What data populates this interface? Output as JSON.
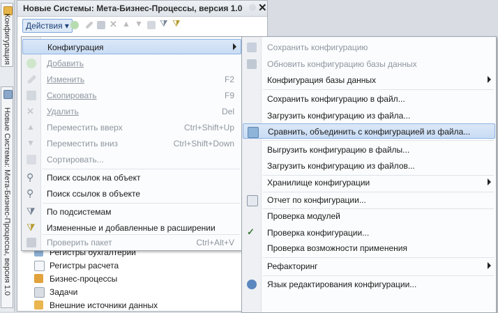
{
  "sidebar": {
    "tabs": [
      {
        "label": "Конфигурация"
      },
      {
        "label": "Новые Системы: Мета-Бизнес-Процессы, версия 1.0"
      }
    ]
  },
  "panel": {
    "title": "Новые Системы: Мета-Бизнес-Процессы, версия 1.0",
    "close_glyph": "✕",
    "actions_label": "Действия ▾",
    "toolbar_icons": [
      "add-icon",
      "edit-icon",
      "copy-icon",
      "delete-icon",
      "move-up-icon",
      "move-down-icon",
      "sort-icon",
      "filter-icon",
      "filter-changed-icon"
    ]
  },
  "tree": [
    {
      "label": "Регистры бухгалтерии",
      "icon": "accounting-register-icon"
    },
    {
      "label": "Регистры расчета",
      "icon": "calculation-register-icon"
    },
    {
      "label": "Бизнес-процессы",
      "icon": "business-process-icon"
    },
    {
      "label": "Задачи",
      "icon": "task-icon"
    },
    {
      "label": "Внешние источники данных",
      "icon": "external-data-source-icon"
    }
  ],
  "actions_menu": [
    {
      "label": "Конфигурация",
      "shortcut": "",
      "disabled": false,
      "highlighted": true,
      "submenu": true,
      "icon": ""
    },
    {
      "label": "Добавить",
      "shortcut": "",
      "disabled": true,
      "underline": true,
      "icon": "add-icon"
    },
    {
      "label": "Изменить",
      "shortcut": "F2",
      "disabled": true,
      "underline": true,
      "icon": "edit-icon"
    },
    {
      "label": "Скопировать",
      "shortcut": "F9",
      "disabled": true,
      "underline": true,
      "icon": "copy-icon"
    },
    {
      "label": "Удалить",
      "shortcut": "Del",
      "disabled": true,
      "underline": true,
      "icon": "delete-icon"
    },
    {
      "label": "Переместить вверх",
      "shortcut": "Ctrl+Shift+Up",
      "disabled": true,
      "icon": "move-up-icon"
    },
    {
      "label": "Переместить вниз",
      "shortcut": "Ctrl+Shift+Down",
      "disabled": true,
      "icon": "move-down-icon"
    },
    {
      "label": "Сортировать...",
      "shortcut": "",
      "disabled": true,
      "icon": "sort-icon"
    },
    {
      "label": "Поиск ссылок на объект",
      "shortcut": "",
      "disabled": false,
      "icon": "find-references-icon"
    },
    {
      "label": "Поиск ссылок в объекте",
      "shortcut": "",
      "disabled": false,
      "icon": "find-in-object-icon"
    },
    {
      "label": "По подсистемам",
      "shortcut": "",
      "disabled": false,
      "icon": "subsystems-filter-icon"
    },
    {
      "label": "Измененные и добавленные в расширении",
      "shortcut": "",
      "disabled": false,
      "icon": "extension-changes-icon"
    },
    {
      "label": "Проверить пакет",
      "shortcut": "Ctrl+Alt+V",
      "disabled": true,
      "icon": "check-package-icon"
    }
  ],
  "config_submenu": [
    {
      "label": "Сохранить конфигурацию",
      "disabled": true,
      "icon": "save-config-icon"
    },
    {
      "label": "Обновить конфигурацию базы данных",
      "disabled": true,
      "icon": "update-db-icon"
    },
    {
      "label": "Конфигурация базы данных",
      "disabled": false,
      "submenu": true
    },
    {
      "label": "Сохранить конфигурацию в файл...",
      "disabled": false
    },
    {
      "label": "Загрузить конфигурацию из файла...",
      "disabled": false
    },
    {
      "label": "Сравнить, объединить с конфигурацией из файла...",
      "disabled": false,
      "highlighted": true,
      "icon": "compare-merge-icon"
    },
    {
      "label": "Выгрузить конфигурацию в файлы...",
      "disabled": false
    },
    {
      "label": "Загрузить конфигурацию из файлов...",
      "disabled": false
    },
    {
      "label": "Хранилище конфигурации",
      "disabled": false,
      "submenu": true
    },
    {
      "label": "Отчет по конфигурации...",
      "disabled": false,
      "icon": "report-icon"
    },
    {
      "label": "Проверка модулей",
      "disabled": false
    },
    {
      "label": "Проверка конфигурации...",
      "disabled": false,
      "icon": "check-config-icon"
    },
    {
      "label": "Проверка возможности применения",
      "disabled": false
    },
    {
      "label": "Рефакторинг",
      "disabled": false,
      "submenu": true
    },
    {
      "label": "Язык редактирования конфигурации...",
      "disabled": false,
      "icon": "language-icon"
    }
  ],
  "colors": {
    "accent": "#1b3f77",
    "highlight": "#c9dcf4",
    "disabled_text": "#8e96a0"
  }
}
